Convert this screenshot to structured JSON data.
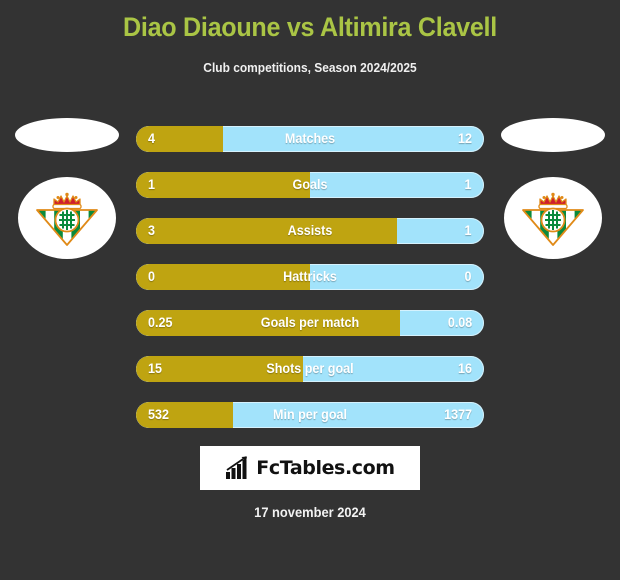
{
  "header": {
    "title": "Diao Diaoune vs Altimira Clavell",
    "subtitle": "Club competitions, Season 2024/2025",
    "title_color": "#aac545"
  },
  "theme": {
    "background": "#333333",
    "left_color": "#bfa411",
    "right_color": "#a2e3fb",
    "text_color": "#ffffff"
  },
  "left_side": {
    "photo_alt": "player-photo",
    "club_crest": "real-betis-crest"
  },
  "right_side": {
    "photo_alt": "player-photo",
    "club_crest": "real-betis-crest"
  },
  "chart_data": {
    "type": "bar",
    "title": "Diao Diaoune vs Altimira Clavell",
    "subtitle": "Club competitions, Season 2024/2025",
    "orientation": "horizontal-diverging",
    "legend": [
      "Diao Diaoune",
      "Altimira Clavell"
    ],
    "categories": [
      "Matches",
      "Goals",
      "Assists",
      "Hattricks",
      "Goals per match",
      "Shots per goal",
      "Min per goal"
    ],
    "series": [
      {
        "name": "Diao Diaoune",
        "color": "#bfa411",
        "values": [
          4,
          1,
          3,
          0,
          0.25,
          15,
          532
        ]
      },
      {
        "name": "Altimira Clavell",
        "color": "#a2e3fb",
        "values": [
          12,
          1,
          1,
          0,
          0.08,
          16,
          1377
        ]
      }
    ]
  },
  "rows": [
    {
      "label": "Matches",
      "left": "4",
      "right": "12",
      "fill_pct": 25
    },
    {
      "label": "Goals",
      "left": "1",
      "right": "1",
      "fill_pct": 50
    },
    {
      "label": "Assists",
      "left": "3",
      "right": "1",
      "fill_pct": 75
    },
    {
      "label": "Hattricks",
      "left": "0",
      "right": "0",
      "fill_pct": 50
    },
    {
      "label": "Goals per match",
      "left": "0.25",
      "right": "0.08",
      "fill_pct": 76
    },
    {
      "label": "Shots per goal",
      "left": "15",
      "right": "16",
      "fill_pct": 48
    },
    {
      "label": "Min per goal",
      "left": "532",
      "right": "1377",
      "fill_pct": 28
    }
  ],
  "footer": {
    "logo_text": "FcTables.com",
    "logo_icon": "bar-chart-growth-icon",
    "date": "17 november 2024"
  }
}
